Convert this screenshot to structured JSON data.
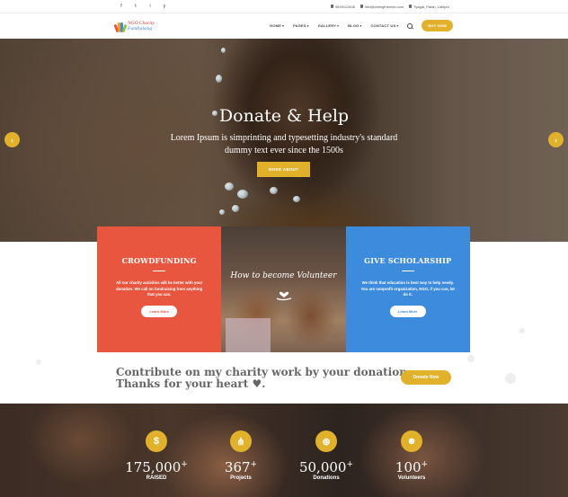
{
  "topbar": {
    "social": [
      "f",
      "t",
      "i",
      "y"
    ],
    "phone": "9849112406",
    "email": "info@cbengthemes.com",
    "address": "Tyagal, Patan, Lalitpur"
  },
  "logo": {
    "line1": "NGO Charity",
    "line2": "Fundraising"
  },
  "nav": {
    "items": [
      "HOME",
      "PAGES",
      "GALLERY",
      "BLOG",
      "CONTACT US"
    ],
    "buy_label": "BUY NOW"
  },
  "hero": {
    "title": "Donate & Help",
    "subtitle": "Lorem Ipsum is simprinting and typesetting industry's standard dummy text ever since the 1500s",
    "button": "MORE ABOUT",
    "prev": "‹",
    "next": "›"
  },
  "features": {
    "crowd": {
      "title": "CROWDFUNDING",
      "text": "All our charity activities will be better with your donation. We call on fundraising from anything that you can.",
      "button": "Learn More"
    },
    "volunteer": {
      "title": "How to become Volunteer"
    },
    "scholar": {
      "title": "GIVE SCHOLARSHIP",
      "text": "We think that education is best way to help needy. You are nonprofit organization, NGO, if you can, let do it.",
      "button": "Learn More"
    }
  },
  "contribute": {
    "line1": "Contribute on my charity work by your donation.",
    "line2": "Thanks for your heart ♥.",
    "button": "Donate Now"
  },
  "stats": [
    {
      "icon": "$",
      "icon_name": "dollar-icon",
      "value": "175,000",
      "plus": "+",
      "label": "RAISED"
    },
    {
      "icon": "⋔",
      "icon_name": "share-icon",
      "value": "367",
      "plus": "+",
      "label": "Projects"
    },
    {
      "icon": "⊛",
      "icon_name": "donation-icon",
      "value": "50,000",
      "plus": "+",
      "label": "Donations"
    },
    {
      "icon": "☻",
      "icon_name": "volunteers-icon",
      "value": "100",
      "plus": "+",
      "label": "Volunteers"
    }
  ],
  "colors": {
    "accent": "#e1b12c",
    "red": "#e8563f",
    "blue": "#3d8bdc"
  }
}
